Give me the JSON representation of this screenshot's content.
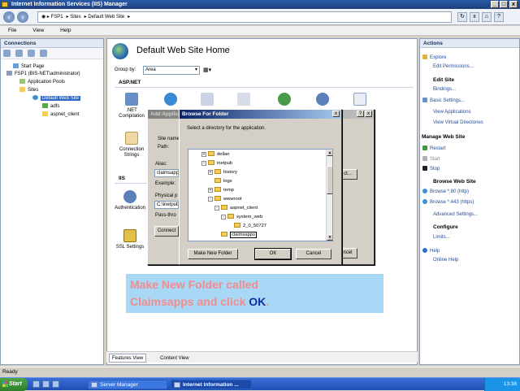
{
  "window": {
    "title": "Internet Information Services (IIS) Manager"
  },
  "address": {
    "segments": [
      "FSP1",
      "Sites",
      "Default Web Site"
    ]
  },
  "menu": [
    "File",
    "View",
    "Help"
  ],
  "connections": {
    "header": "Connections",
    "tree": {
      "start_page": "Start Page",
      "server": "FSP1 (BIS-NET\\administrator)",
      "app_pools": "Application Pools",
      "sites": "Sites",
      "default_site": "Default Web Site",
      "adfs": "adfs",
      "aspnet_client": "aspnet_client"
    }
  },
  "main": {
    "title": "Default Web Site Home",
    "group_by_label": "Group by:",
    "group_by_value": "Area",
    "section_aspnet": "ASP.NET",
    "section_iis": "IIS",
    "features": {
      "net_compilation": ".NET Compilation",
      "connection_strings": "Connection Strings",
      "authentication": "Authentication",
      "ssl_settings": "SSL Settings"
    },
    "tabs": {
      "features_view": "Features View",
      "content_view": "Content View"
    }
  },
  "add_app_dialog": {
    "title": "Add Application",
    "site_name_label": "Site name:",
    "path_label": "Path:",
    "alias_label": "Alias:",
    "alias_value": "claimsapp",
    "example_label": "Example:",
    "physical_path_label": "Physical p",
    "physical_path_value": "C:\\inetpub",
    "pass_through_label": "Pass-thro",
    "connect_label": "Connect",
    "select_label": "ct...",
    "cancel_label": "ncel"
  },
  "browse_dialog": {
    "title": "Browse For Folder",
    "instruction": "Select a directory for the application.",
    "folders": {
      "dellan": "dellan",
      "inetpub": "inetpub",
      "history": "history",
      "logs": "logs",
      "temp": "temp",
      "wwwroot": "wwwroot",
      "aspnet_client": "aspnet_client",
      "system_web": "system_web",
      "version": "2_0_50727",
      "new_folder": "claimsapps"
    },
    "make_new_folder_label": "Make New Folder",
    "ok_label": "OK",
    "cancel_label": "Cancel"
  },
  "callout": {
    "line1": "Make New Folder called",
    "line2_start": "Claimsapps and click ",
    "line2_ok": "OK",
    "line2_end": "."
  },
  "actions": {
    "header": "Actions",
    "explore": "Explore",
    "edit_permissions": "Edit Permissions...",
    "edit_site_header": "Edit Site",
    "bindings": "Bindings...",
    "basic_settings": "Basic Settings...",
    "view_applications": "View Applications",
    "view_virtual_directories": "View Virtual Directories",
    "manage_header": "Manage Web Site",
    "restart": "Restart",
    "start": "Start",
    "stop": "Stop",
    "browse_header": "Browse Web Site",
    "browse_80": "Browse *:80 (http)",
    "browse_443": "Browse *:443 (https)",
    "advanced_settings": "Advanced Settings...",
    "configure_header": "Configure",
    "limits": "Limits...",
    "help": "Help",
    "online_help": "Online Help"
  },
  "status": {
    "text": "Ready"
  },
  "taskbar": {
    "start_label": "Start",
    "tasks": [
      "Server Manager",
      "Internet Information ..."
    ],
    "clock": "13:38"
  },
  "colors": {
    "accent_blue": "#3169c6",
    "callout_bg": "#a9d8f7",
    "callout_text": "#f28b8b",
    "callout_ok": "#0b2f9c"
  }
}
